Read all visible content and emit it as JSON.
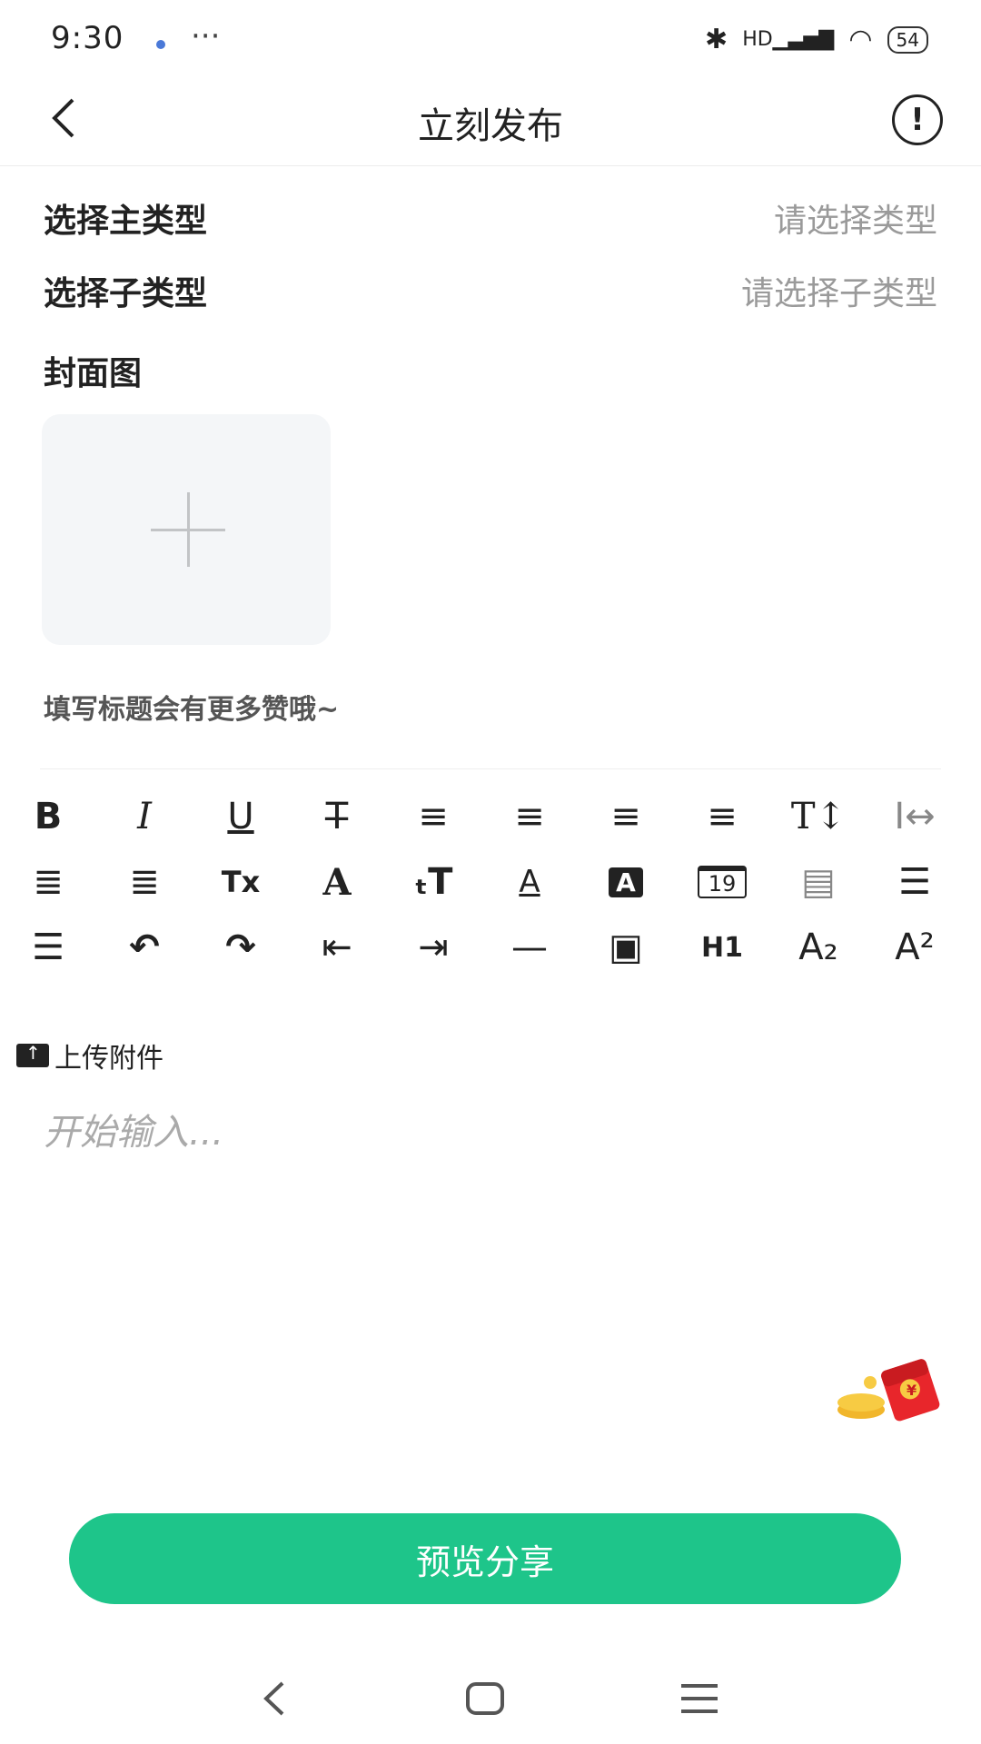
{
  "status_bar": {
    "time": "9:30",
    "more": "···",
    "network": "HD",
    "battery": "54"
  },
  "header": {
    "title": "立刻发布"
  },
  "form": {
    "main_type": {
      "label": "选择主类型",
      "value": "请选择类型"
    },
    "sub_type": {
      "label": "选择子类型",
      "value": "请选择子类型"
    },
    "cover": {
      "label": "封面图"
    },
    "title_placeholder": "填写标题会有更多赞哦~"
  },
  "toolbar": {
    "rows": [
      [
        "B",
        "I",
        "U",
        "T̶",
        "≡",
        "≡",
        "≡",
        "≡",
        "T↕",
        "I↔"
      ],
      [
        "≣",
        "≣",
        "Tx",
        "A",
        "ₜT",
        "A",
        "A",
        "19",
        "▤",
        "☰"
      ],
      [
        "☰",
        "↶",
        "↷",
        "⇤",
        "⇥",
        "—",
        "▣",
        "H1",
        "A₂",
        "A²"
      ]
    ]
  },
  "upload": {
    "label": "上传附件"
  },
  "editor": {
    "placeholder": "开始输入..."
  },
  "redpacket": {
    "symbol": "¥"
  },
  "actions": {
    "preview_label": "预览分享"
  },
  "colors": {
    "accent": "#1ec58a",
    "placeholder": "#9a9a9a",
    "cover_bg": "#f4f6f8"
  }
}
